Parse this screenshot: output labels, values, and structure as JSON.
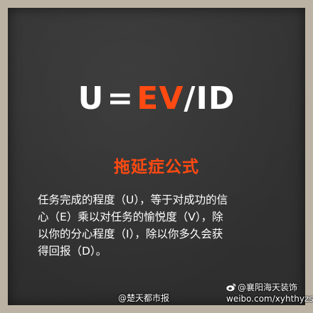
{
  "formula": {
    "u": "U",
    "eq": "=",
    "ev": "EV",
    "slash_id": "/ID"
  },
  "headline": "拖延症公式",
  "body_lines": [
    "任务完成的程度（U），等于对成功的信",
    "心（E）乘以对任务的愉悦度（V），除",
    "以你的分心程度（I），除以你多久会获",
    "得回报（D）。"
  ],
  "watermarks": {
    "left": "@楚天都市报",
    "right_handle": "@襄阳海天装饰",
    "right_url": "weibo.com/xyhthyzs",
    "icon": "weibo-icon"
  },
  "colors": {
    "accent": "#ff4a12",
    "panel": "#333333",
    "frame": "#bcb2a3",
    "text": "#ffffff"
  }
}
